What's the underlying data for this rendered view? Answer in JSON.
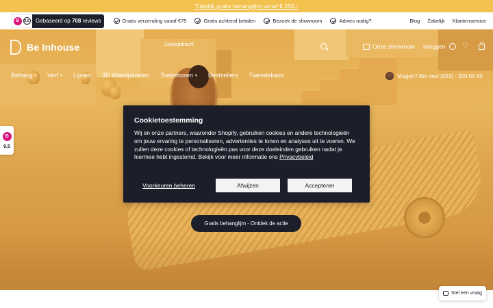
{
  "promo": {
    "text": "Tijdelijk gratis behanglijm vanaf € 250,-"
  },
  "usp_bar": {
    "rating_score": "9,5",
    "rating_text_prefix": "Gebaseerd op ",
    "rating_count": "708",
    "rating_text_suffix": " reviews",
    "items": [
      "Gratis verzending vanaf €75",
      "Gratis achteraf betalen",
      "Bezoek de showroom",
      "Advies nodig?"
    ],
    "links": [
      "Blog",
      "Zakelijk",
      "Klantenservice"
    ]
  },
  "header": {
    "brand": "Be Inhouse",
    "search_placeholder": "Zoekopdracht",
    "showroom": "Onze showroom",
    "login": "Inloggen"
  },
  "nav": {
    "items": [
      {
        "label": "Behang",
        "dropdown": true
      },
      {
        "label": "Verf",
        "dropdown": true
      },
      {
        "label": "Lijsten",
        "dropdown": false
      },
      {
        "label": "3D Wandpanelen",
        "dropdown": false
      },
      {
        "label": "Toebehoren",
        "dropdown": true
      },
      {
        "label": "Bestsellers",
        "dropdown": false
      },
      {
        "label": "Tweedekans",
        "dropdown": false
      }
    ],
    "contact": "Vragen? Bel ons! (053) - 200 56 63"
  },
  "side_widget": {
    "score": "9,5"
  },
  "cookie": {
    "title": "Cookietoestemming",
    "body": "Wij en onze partners, waaronder Shopify, gebruiken cookies en andere technologieën om jouw ervaring te personaliseren, advertenties te tonen en analyses uit te voeren. We zullen deze cookies of technologieën pas voor deze doeleinden gebruiken nadat je hiermee hebt ingestemd. Bekijk voor meer informatie ons ",
    "privacy_link": "Privacybeleid",
    "manage": "Voorkeuren beheren",
    "reject": "Afwijzen",
    "accept": "Accepteren"
  },
  "hero": {
    "cta": "Gratis behanglijm - Ontdek de actie"
  },
  "help": {
    "label": "Stel een vraag"
  },
  "colors": {
    "promo": "#f2c14e",
    "dark": "#1c1e2a",
    "kiyoh": "#d6127a"
  }
}
